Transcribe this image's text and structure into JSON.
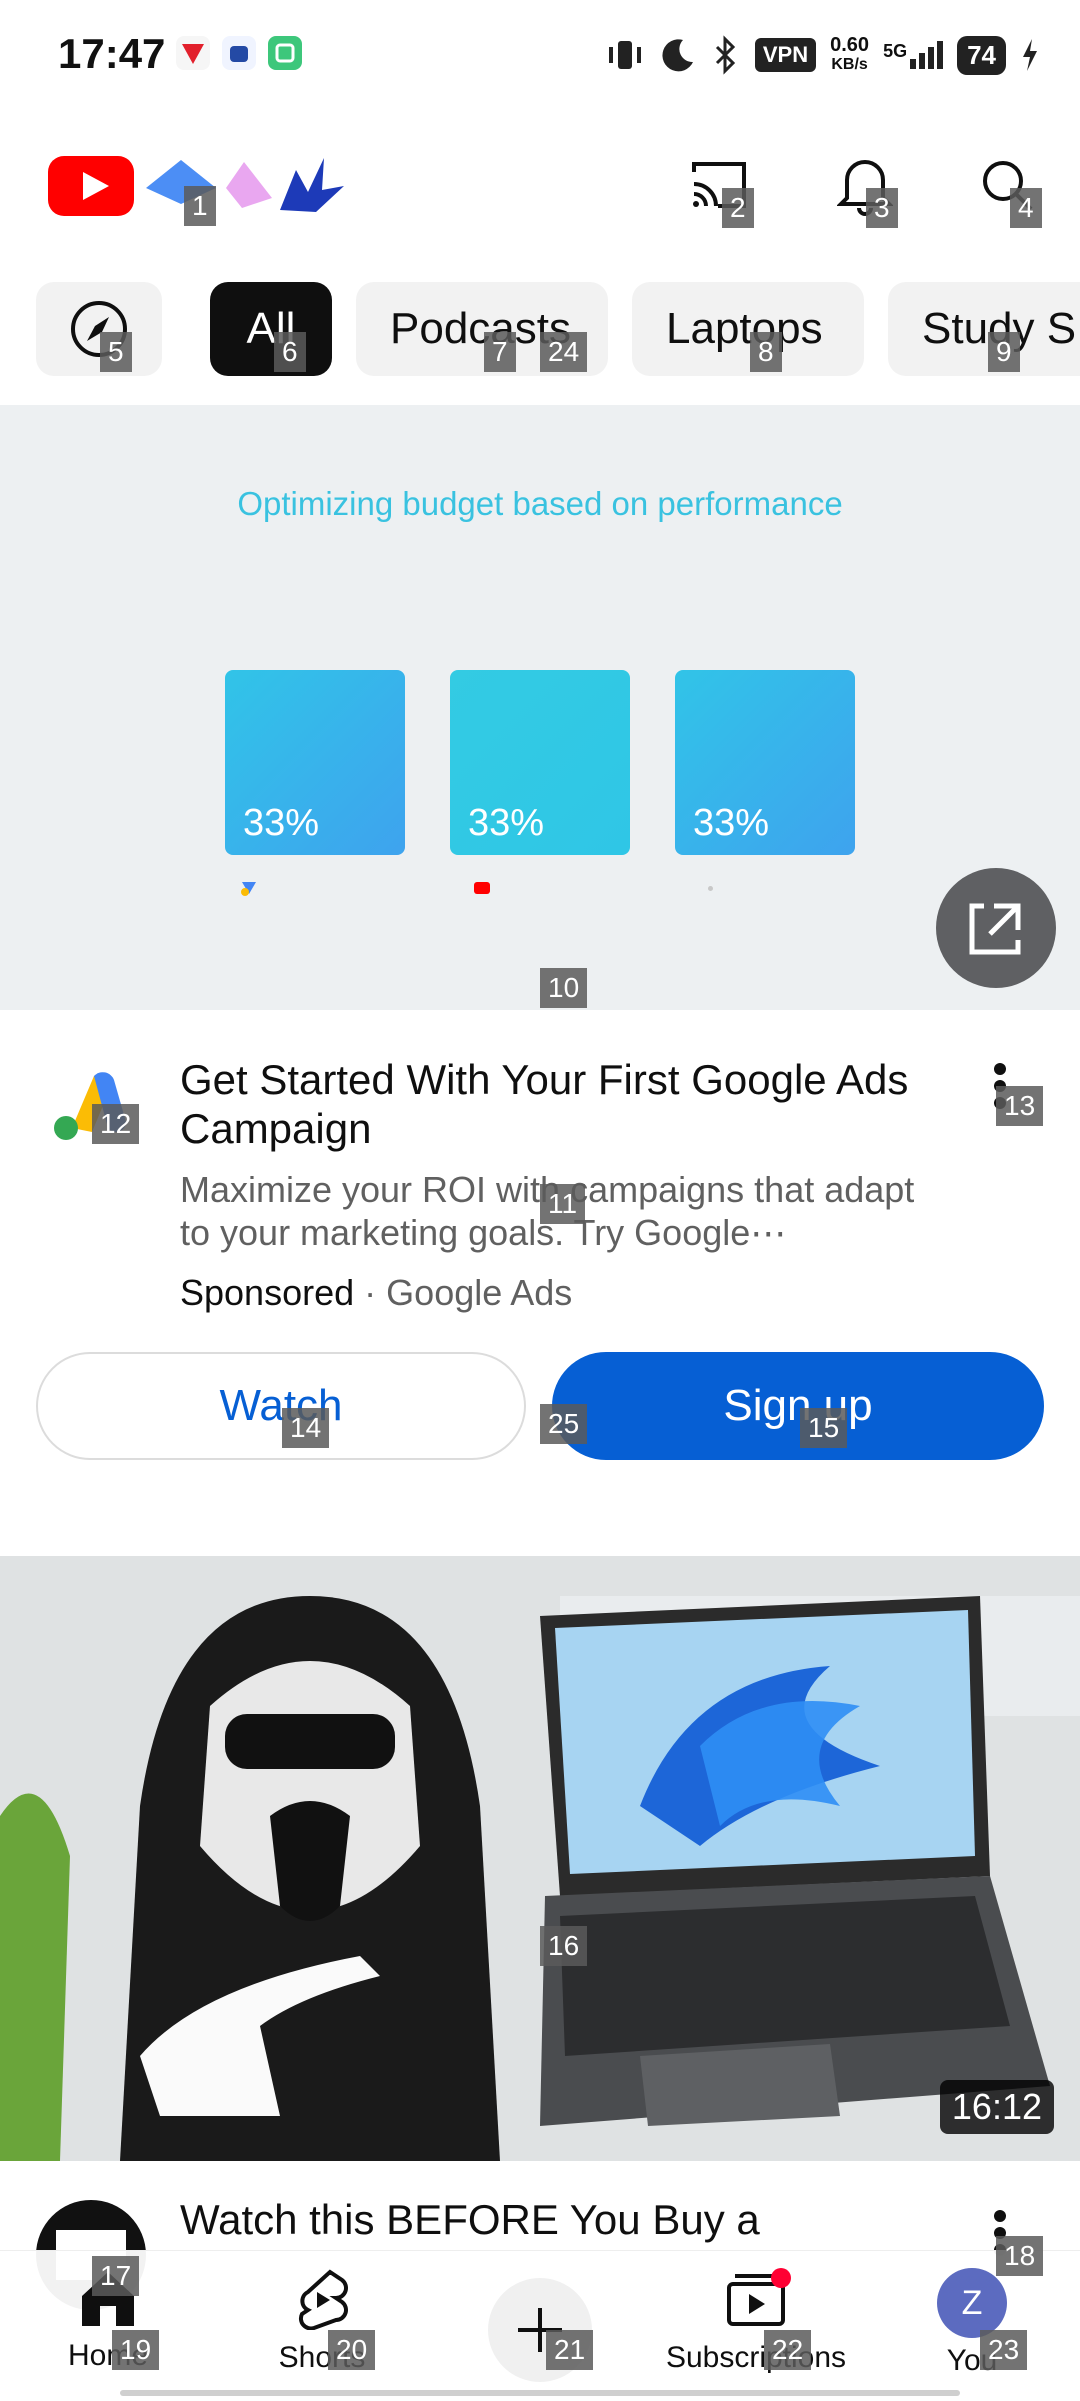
{
  "status_bar": {
    "time": "17:47",
    "vpn": "VPN",
    "speed_value": "0.60",
    "speed_unit": "KB/s",
    "network": "5G",
    "battery": "74",
    "icons": [
      "vibrate-icon",
      "moon-icon",
      "bluetooth-icon",
      "signal-icon",
      "charging-icon"
    ]
  },
  "header": {
    "logo": "youtube-logo",
    "cast": "cast-icon",
    "notifications": "bell-icon",
    "search": "search-icon"
  },
  "chips": [
    "All",
    "Podcasts",
    "Laptops",
    "Study S"
  ],
  "explore_icon": "compass-icon",
  "ad": {
    "headline": "Optimizing budget based on performance",
    "bars": [
      "33%",
      "33%",
      "33%"
    ],
    "title": "Get Started With Your First Google Ads Campaign",
    "description": "Maximize your ROI with campaigns that adapt to your marketing goals. Try Google⋯",
    "sponsored": "Sponsored",
    "separator": "·",
    "advertiser": "Google Ads",
    "watch_label": "Watch",
    "signup_label": "Sign up",
    "brand_color": "#065fd4"
  },
  "video": {
    "duration": "16:12",
    "title": "Watch this BEFORE You Buy a"
  },
  "nav": {
    "home": "Home",
    "shorts": "Shorts",
    "subscriptions": "Subscriptions",
    "you": "You",
    "avatar_letter": "Z"
  },
  "tags": [
    "1",
    "2",
    "3",
    "4",
    "5",
    "6",
    "7",
    "8",
    "9",
    "10",
    "11",
    "12",
    "13",
    "14",
    "15",
    "16",
    "17",
    "18",
    "19",
    "20",
    "21",
    "22",
    "23",
    "24",
    "25"
  ]
}
